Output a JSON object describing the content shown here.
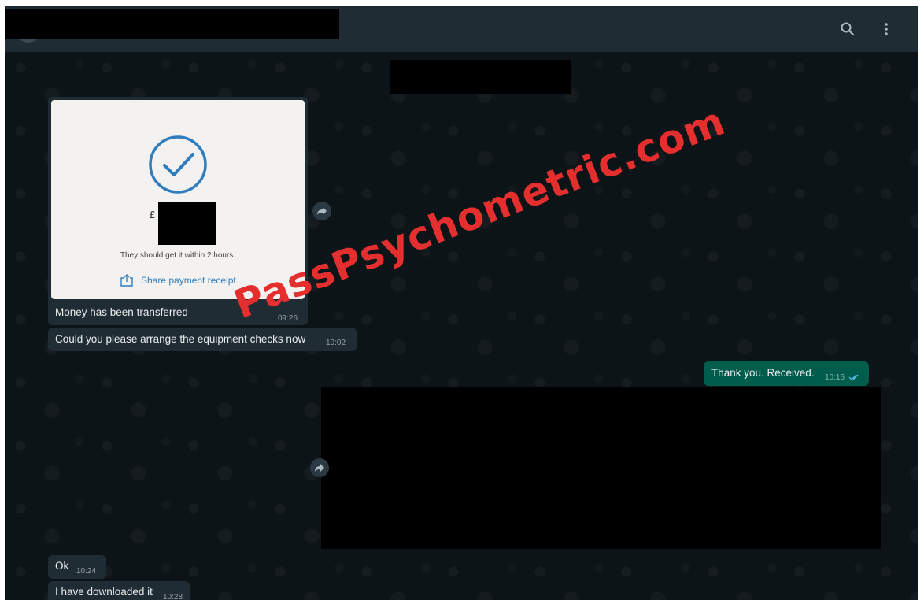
{
  "chat": {
    "messages": [
      {
        "direction": "incoming",
        "type": "image",
        "receipt": {
          "amount_prefix": "£",
          "note": "They should get it within 2 hours.",
          "share_label": "Share payment receipt"
        },
        "caption": "Money has been transferred",
        "time": "09:26"
      },
      {
        "direction": "incoming",
        "type": "text",
        "text": "Could you please arrange the equipment checks now",
        "time": "10:02"
      },
      {
        "direction": "outgoing",
        "type": "text",
        "text": "Thank you. Received.",
        "time": "10:16",
        "status": "read"
      },
      {
        "direction": "incoming",
        "type": "text",
        "text": "Ok",
        "time": "10:24"
      },
      {
        "direction": "incoming",
        "type": "text",
        "text": "I have downloaded it",
        "time": "10:28"
      }
    ]
  },
  "header": {
    "icons": [
      "search-icon",
      "more-vertical-icon"
    ]
  },
  "watermark": "PassPsychometric.com",
  "colors": {
    "incoming_bubble": "#202c33",
    "outgoing_bubble": "#005c4b",
    "chat_background": "#0d1418",
    "header": "#1f2c33",
    "watermark": "#e52f2f",
    "check_icon": "#2f7dbd",
    "read_ticks": "#53bdeb"
  }
}
